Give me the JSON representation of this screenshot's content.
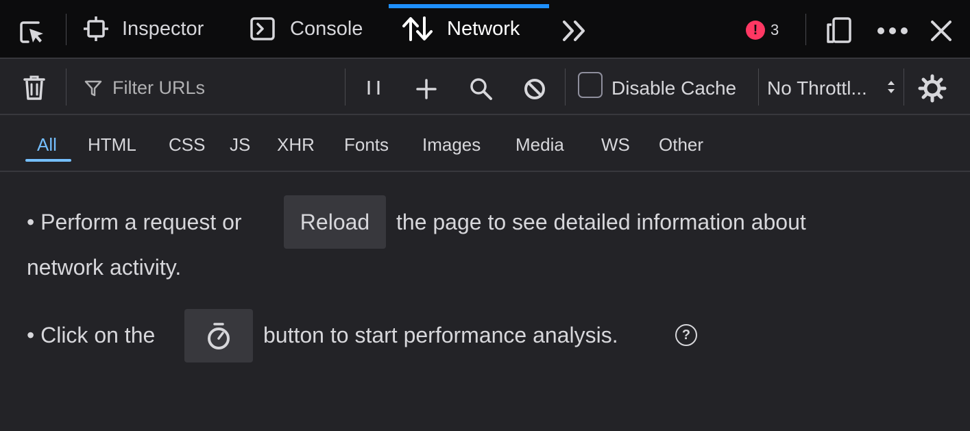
{
  "tabs": {
    "inspector": "Inspector",
    "console": "Console",
    "network": "Network"
  },
  "errors": {
    "count": "3",
    "icon": "!"
  },
  "toolbar": {
    "filter_placeholder": "Filter URLs",
    "disable_cache": "Disable Cache",
    "throttling": "No Throttl...",
    "throttling_arrow": "↕"
  },
  "type_filters": [
    "All",
    "HTML",
    "CSS",
    "JS",
    "XHR",
    "Fonts",
    "Images",
    "Media",
    "WS",
    "Other"
  ],
  "notice": {
    "line1_before": "• Perform a request or",
    "reload": "Reload",
    "line1_after": "the page to see detailed information about",
    "line2": "network activity.",
    "line3_before": "• Click on the",
    "line3_after": "button to start performance analysis.",
    "help": "?"
  },
  "colors": {
    "accent": "#1e90ff",
    "active_filter": "#75bfff",
    "error": "#ff3863",
    "background": "#232327"
  },
  "icons": [
    "pick-element-icon",
    "inspector-icon",
    "console-icon",
    "network-icon",
    "chevron-double-right-icon",
    "error-icon",
    "responsive-design-icon",
    "more-options-icon",
    "close-icon",
    "trash-icon",
    "filter-icon",
    "pause-icon",
    "plus-icon",
    "search-icon",
    "block-icon",
    "settings-gear-icon",
    "stopwatch-icon",
    "help-icon"
  ]
}
